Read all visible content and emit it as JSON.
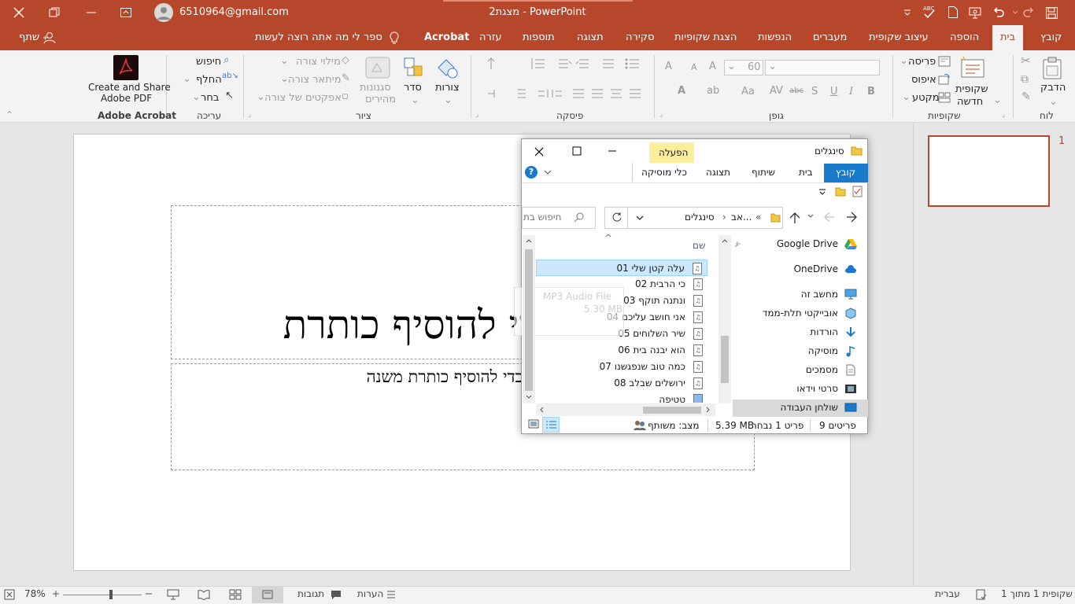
{
  "titlebar": {
    "doc_title": "מצגת2 - PowerPoint",
    "account": "6510964@gmail.com"
  },
  "tabs": [
    "קובץ",
    "בית",
    "הוספה",
    "עיצוב שקופית",
    "מעברים",
    "הנפשות",
    "הצגת שקופיות",
    "סקירה",
    "תצוגה",
    "תוספות",
    "עזרה",
    "Acrobat"
  ],
  "active_tab": "בית",
  "tell_me": "ספר לי מה אתה רוצה לעשות",
  "share": "שתף",
  "ribbon": {
    "groups": {
      "clipboard": "לוח",
      "slides": "שקופיות",
      "font": "גופן",
      "paragraph": "פיסקה",
      "drawing": "ציור",
      "editing": "עריכה",
      "acrobat": "Adobe Acrobat"
    },
    "paste": "הדבק",
    "new_slide_1": "שקופית",
    "new_slide_2": "חדשה",
    "layout": "פריסה",
    "reset": "איפוס",
    "section": "מקטע",
    "font_size": "60",
    "shapes": "צורות",
    "arrange": "סדר",
    "quick_styles_1": "סגנונות",
    "quick_styles_2": "מהירים",
    "shape_fill": "מילוי צורה",
    "shape_outline": "מיתאר צורה",
    "shape_effects": "אפקטים של צורה",
    "find": "חיפוש",
    "replace": "החלף",
    "select": "בחר",
    "create_pdf_1": "Create and Share",
    "create_pdf_2": "Adobe PDF"
  },
  "slide": {
    "title_placeholder": "לחצי כדי להוסיף כותרת",
    "subtitle_placeholder": "לחצי כדי להוסיף כותרת משנה"
  },
  "thumbnail": {
    "number": "1"
  },
  "status": {
    "slide_info": "שקופית 1 מתוך 1",
    "language": "עברית",
    "notes": "הערות",
    "comments": "תגובות",
    "zoom": "78%"
  },
  "explorer": {
    "title": "סינגלים",
    "manage_tab": "הפעלה",
    "tabs": [
      "קובץ",
      "בית",
      "שיתוף",
      "תצוגה"
    ],
    "music_tools": "כלי מוסיקה",
    "breadcrumb_short": "אב...",
    "breadcrumb_current": "סינגלים",
    "search_placeholder": "חיפוש בת",
    "column_name": "שם",
    "files": [
      "01 עלה קטן שלי",
      "02 כי הרבית",
      "03 ונתנה תוקף",
      "04 אני חושב עליכם",
      "05 שיר השלוחים",
      "06 הוא יבנה בית",
      "07 כמה טוב שנפגשנו",
      "08 ירושלים שבלב",
      "טטיפה"
    ],
    "nav": [
      "Google Drive",
      "OneDrive",
      "מחשב זה",
      "אובייקטי תלת-ממד",
      "הורדות",
      "מוסיקה",
      "מסמכים",
      "סרטי וידאו",
      "שולחן העבודה"
    ],
    "tooltip_type": "MP3 Audio File",
    "tooltip_size": "5.30 MB",
    "status_count": "9 פריטים",
    "status_selected": "פריט 1 נבחר",
    "status_size": "5.39 MB",
    "status_shared": "מצב: משותף"
  }
}
